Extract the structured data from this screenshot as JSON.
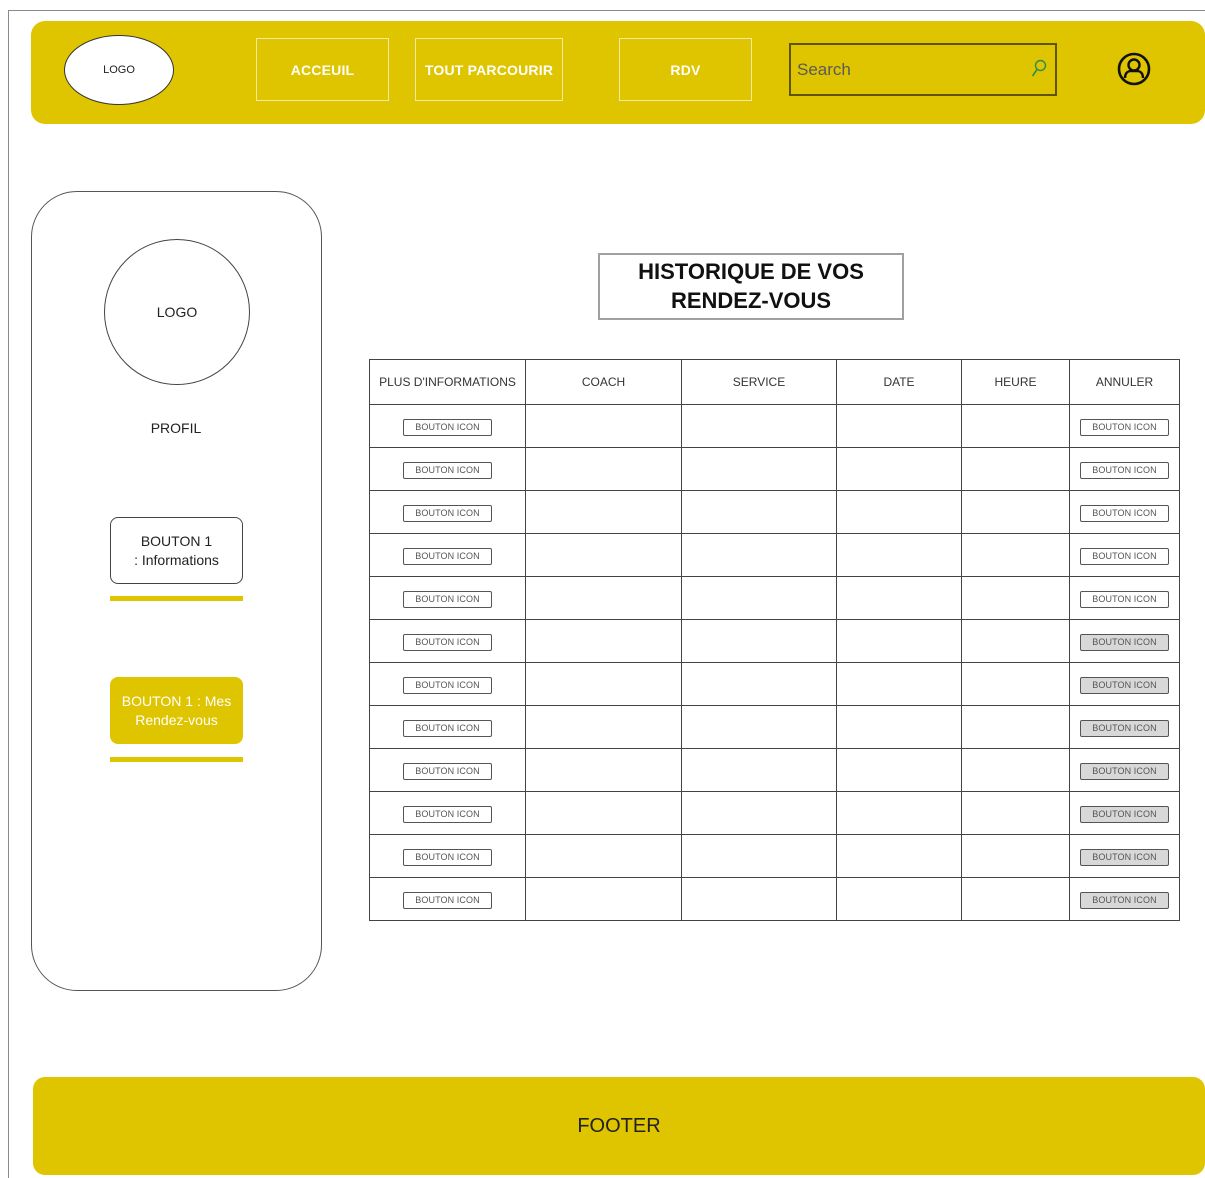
{
  "header": {
    "logo": "LOGO",
    "nav": [
      "ACCEUIL",
      "TOUT PARCOURIR",
      "RDV"
    ],
    "search_placeholder": "Search"
  },
  "sidebar": {
    "logo": "LOGO",
    "profile_label": "PROFIL",
    "button_info": "BOUTON 1\n: Informations",
    "button_rdv": "BOUTON 1 :  Mes\nRendez-vous"
  },
  "main": {
    "title": "HISTORIQUE DE VOS\nRENDEZ-VOUS",
    "columns": [
      "PLUS D'INFORMATIONS",
      "COACH",
      "SERVICE",
      "DATE",
      "HEURE",
      "ANNULER"
    ],
    "row_button_label": "BOUTON ICON",
    "rows": [
      {
        "info": "BOUTON ICON",
        "coach": "",
        "service": "",
        "date": "",
        "heure": "",
        "annuler": "BOUTON ICON",
        "annuler_disabled": false
      },
      {
        "info": "BOUTON ICON",
        "coach": "",
        "service": "",
        "date": "",
        "heure": "",
        "annuler": "BOUTON ICON",
        "annuler_disabled": false
      },
      {
        "info": "BOUTON ICON",
        "coach": "",
        "service": "",
        "date": "",
        "heure": "",
        "annuler": "BOUTON ICON",
        "annuler_disabled": false
      },
      {
        "info": "BOUTON ICON",
        "coach": "",
        "service": "",
        "date": "",
        "heure": "",
        "annuler": "BOUTON ICON",
        "annuler_disabled": false
      },
      {
        "info": "BOUTON ICON",
        "coach": "",
        "service": "",
        "date": "",
        "heure": "",
        "annuler": "BOUTON ICON",
        "annuler_disabled": false
      },
      {
        "info": "BOUTON ICON",
        "coach": "",
        "service": "",
        "date": "",
        "heure": "",
        "annuler": "BOUTON ICON",
        "annuler_disabled": true
      },
      {
        "info": "BOUTON ICON",
        "coach": "",
        "service": "",
        "date": "",
        "heure": "",
        "annuler": "BOUTON ICON",
        "annuler_disabled": true
      },
      {
        "info": "BOUTON ICON",
        "coach": "",
        "service": "",
        "date": "",
        "heure": "",
        "annuler": "BOUTON ICON",
        "annuler_disabled": true
      },
      {
        "info": "BOUTON ICON",
        "coach": "",
        "service": "",
        "date": "",
        "heure": "",
        "annuler": "BOUTON ICON",
        "annuler_disabled": true
      },
      {
        "info": "BOUTON ICON",
        "coach": "",
        "service": "",
        "date": "",
        "heure": "",
        "annuler": "BOUTON ICON",
        "annuler_disabled": true
      },
      {
        "info": "BOUTON ICON",
        "coach": "",
        "service": "",
        "date": "",
        "heure": "",
        "annuler": "BOUTON ICON",
        "annuler_disabled": true
      },
      {
        "info": "BOUTON ICON",
        "coach": "",
        "service": "",
        "date": "",
        "heure": "",
        "annuler": "BOUTON ICON",
        "annuler_disabled": true
      }
    ]
  },
  "footer": {
    "label": "FOOTER"
  },
  "colors": {
    "accent": "#dfc500",
    "disabled_button": "#d8d8d8"
  },
  "icons": {
    "search": "search-icon",
    "user": "user-icon"
  }
}
